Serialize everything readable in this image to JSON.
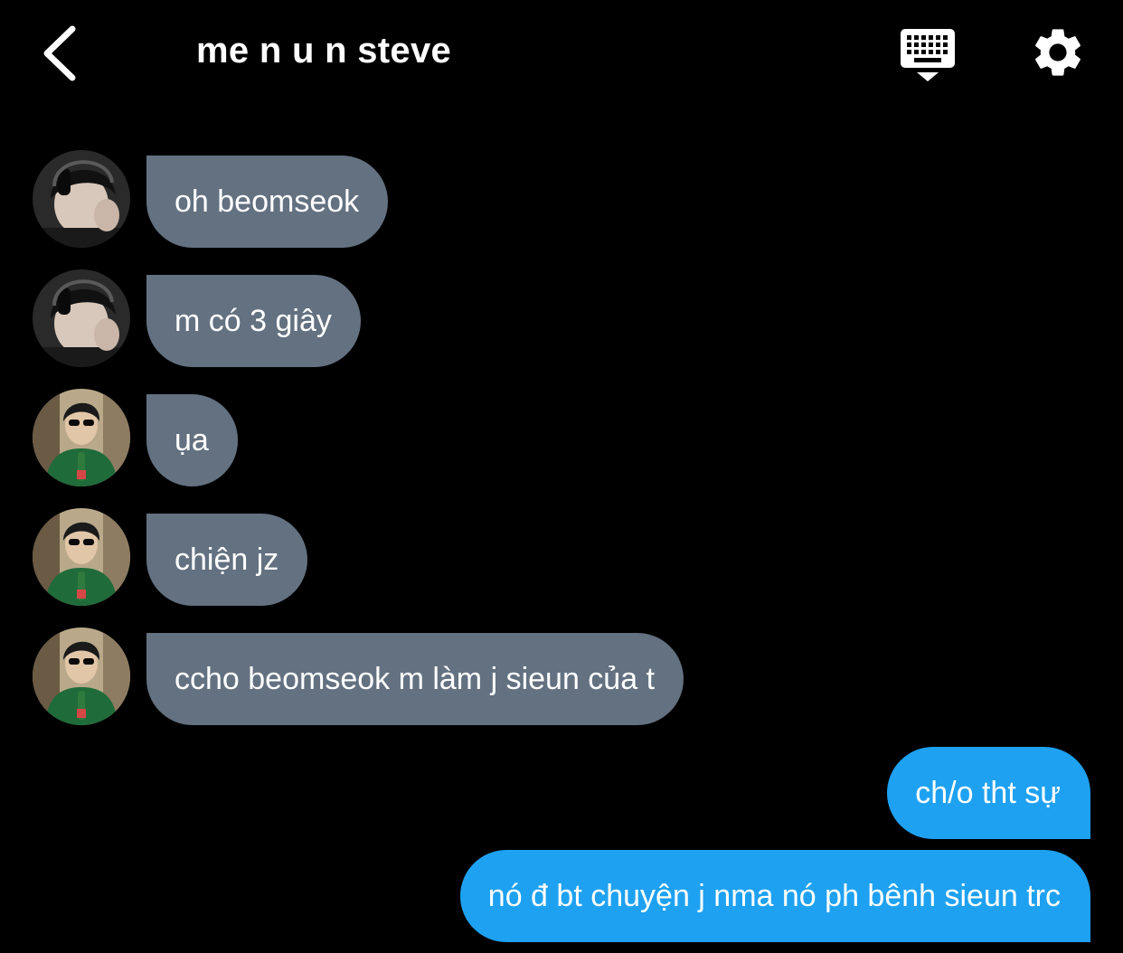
{
  "header": {
    "title": "me n u n steve",
    "back_icon": "chevron-left-icon",
    "keyboard_icon": "keyboard-icon",
    "settings_icon": "gear-icon"
  },
  "colors": {
    "background": "#000000",
    "incoming_bubble": "#637181",
    "outgoing_bubble": "#1ea1f1",
    "text": "#ffffff"
  },
  "messages": [
    {
      "direction": "incoming",
      "sender": "headphones-user",
      "text": "oh beomseok"
    },
    {
      "direction": "incoming",
      "sender": "headphones-user",
      "text": "m có 3 giây"
    },
    {
      "direction": "incoming",
      "sender": "sunglasses-user",
      "text": "ụa"
    },
    {
      "direction": "incoming",
      "sender": "sunglasses-user",
      "text": "chiện jz"
    },
    {
      "direction": "incoming",
      "sender": "sunglasses-user",
      "text": "ccho beomseok m làm j sieun của t"
    },
    {
      "direction": "outgoing",
      "sender": "me",
      "text": "ch/o tht sự"
    },
    {
      "direction": "outgoing",
      "sender": "me",
      "text": "nó đ bt chuyện j nma nó ph bênh sieun trc"
    }
  ]
}
